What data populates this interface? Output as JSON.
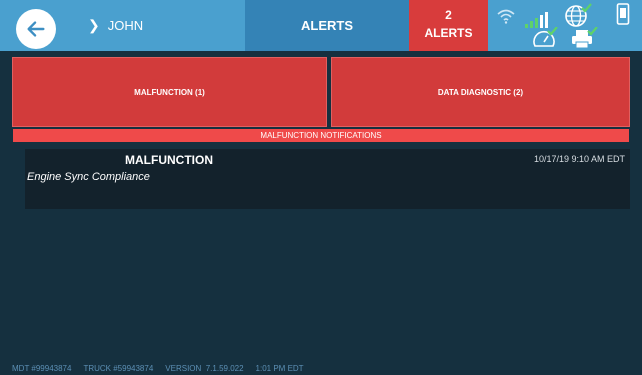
{
  "header": {
    "breadcrumb": "JOHN",
    "title": "ALERTS",
    "alert_count": "2",
    "alert_label": "ALERTS"
  },
  "icons": {
    "back": "arrow-left-icon",
    "chevron": "chevron-right-icon",
    "wifi": "wifi-icon",
    "signal": "signal-bars-icon",
    "globe": "globe-icon",
    "phone": "phone-icon",
    "gauge": "gauge-icon",
    "printer": "printer-icon"
  },
  "buttons": {
    "malfunction": "MALFUNCTION (1)",
    "data_diagnostic": "DATA DIAGNOSTIC (2)"
  },
  "section_title": "MALFUNCTION NOTIFICATIONS",
  "notification": {
    "title": "MALFUNCTION",
    "subtitle": "Engine Sync Compliance",
    "timestamp": "10/17/19 9:10 AM EDT"
  },
  "footer": {
    "mdt": "MDT #99943874",
    "truck": "TRUCK #59943874",
    "version": "VERSION  7.1.59.022",
    "time": "1:01 PM EDT"
  },
  "colors": {
    "header_bg": "#4aa0cf",
    "tab_active": "#3483b6",
    "alert_red": "#d83c3c",
    "body_bg": "#15303f",
    "check_green": "#5ed26a"
  }
}
